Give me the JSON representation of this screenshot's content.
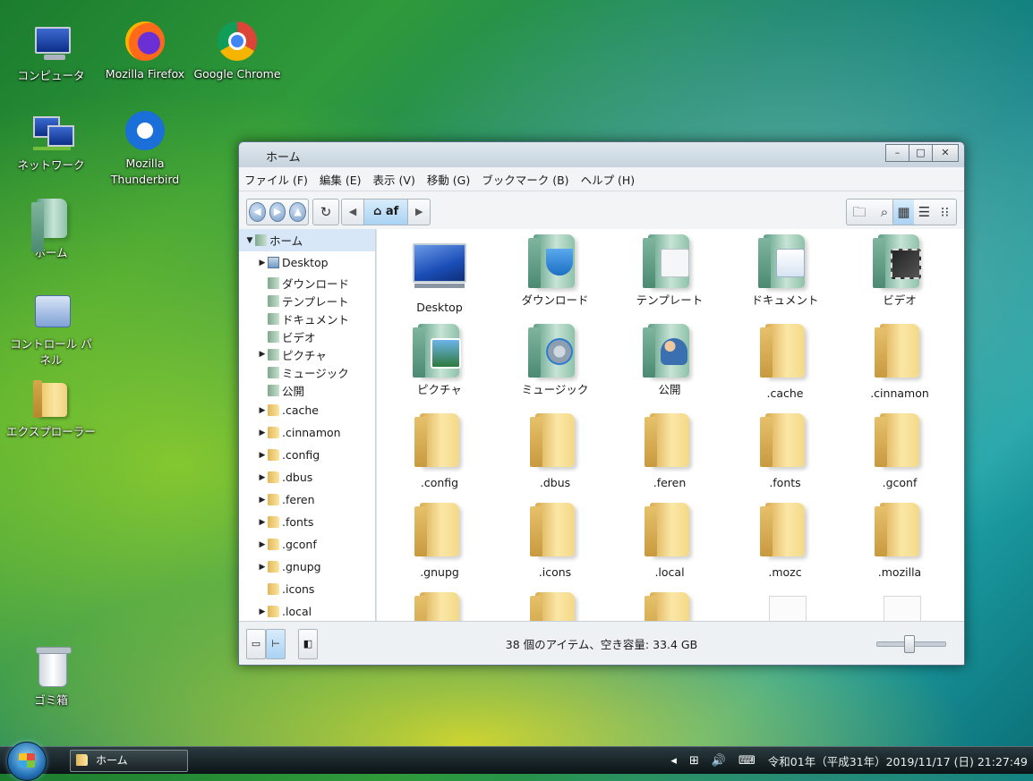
{
  "desktop_icons": [
    {
      "label": "コンピュータ"
    },
    {
      "label": "Mozilla Firefox"
    },
    {
      "label": "Google Chrome"
    },
    {
      "label": "ネットワーク"
    },
    {
      "label_line1": "Mozilla",
      "label_line2": "Thunderbird"
    },
    {
      "label": "ホーム"
    },
    {
      "label": "コントロール パネル"
    },
    {
      "label": "エクスプローラー"
    },
    {
      "label": "ゴミ箱"
    }
  ],
  "window": {
    "title": "ホーム",
    "menu": [
      "ファイル (F)",
      "編集 (E)",
      "表示 (V)",
      "移動 (G)",
      "ブックマーク (B)",
      "ヘルプ (H)"
    ],
    "breadcrumb": "af",
    "sidebar": [
      {
        "label": "ホーム"
      },
      {
        "label": "Desktop"
      },
      {
        "label": "ダウンロード"
      },
      {
        "label": "テンプレート"
      },
      {
        "label": "ドキュメント"
      },
      {
        "label": "ビデオ"
      },
      {
        "label": "ピクチャ"
      },
      {
        "label": "ミュージック"
      },
      {
        "label": "公開"
      },
      {
        "label": ".cache"
      },
      {
        "label": ".cinnamon"
      },
      {
        "label": ".config"
      },
      {
        "label": ".dbus"
      },
      {
        "label": ".feren"
      },
      {
        "label": ".fonts"
      },
      {
        "label": ".gconf"
      },
      {
        "label": ".gnupg"
      },
      {
        "label": ".icons"
      },
      {
        "label": ".local"
      }
    ],
    "files": [
      {
        "label": "Desktop"
      },
      {
        "label": "ダウンロード"
      },
      {
        "label": "テンプレート"
      },
      {
        "label": "ドキュメント"
      },
      {
        "label": "ビデオ"
      },
      {
        "label": "ピクチャ"
      },
      {
        "label": "ミュージック"
      },
      {
        "label": "公開"
      },
      {
        "label": ".cache"
      },
      {
        "label": ".cinnamon"
      },
      {
        "label": ".config"
      },
      {
        "label": ".dbus"
      },
      {
        "label": ".feren"
      },
      {
        "label": ".fonts"
      },
      {
        "label": ".gconf"
      },
      {
        "label": ".gnupg"
      },
      {
        "label": ".icons"
      },
      {
        "label": ".local"
      },
      {
        "label": ".mozc"
      },
      {
        "label": ".mozilla"
      }
    ],
    "status": "38 個のアイテム、空き容量: 33.4 GB"
  },
  "taskbar": {
    "task_label": "ホーム",
    "clock": "令和01年（平成31年）2019/11/17 (日) 21:27:49"
  }
}
